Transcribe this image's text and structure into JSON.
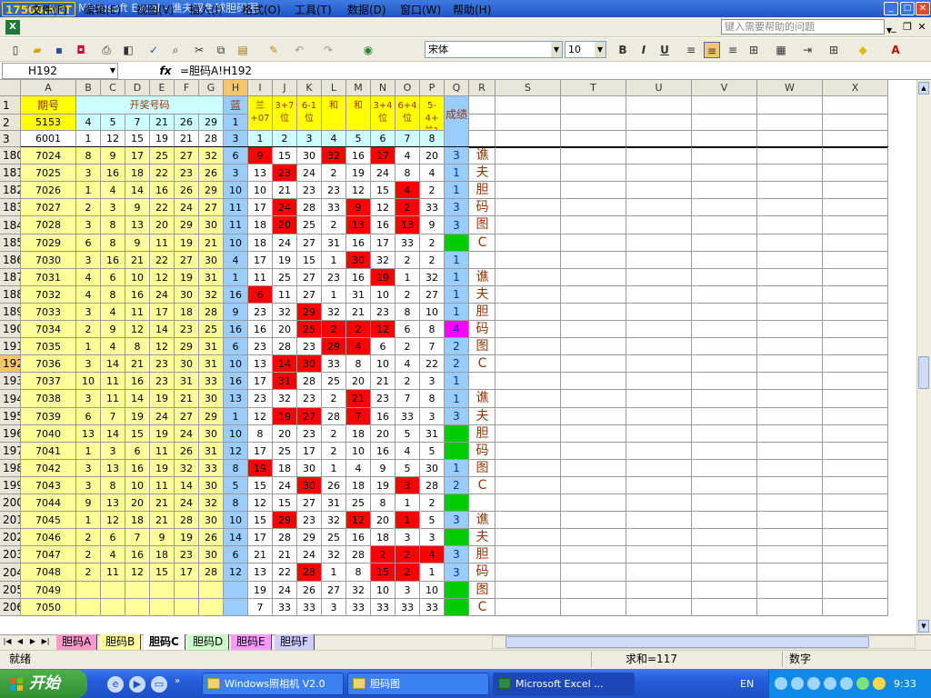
{
  "window": {
    "logo": "17500.NET",
    "title": "Microsoft Excel - 谯夫双色球胆码图"
  },
  "menu": [
    "文件(F)",
    "编辑(E)",
    "视图(V)",
    "插入(I)",
    "格式(O)",
    "工具(T)",
    "数据(D)",
    "窗口(W)",
    "帮助(H)"
  ],
  "help_placeholder": "键入需要帮助的问题",
  "font_name": "宋体",
  "font_size": "10",
  "name_box": "H192",
  "formula": "=胆码A!H192",
  "columns": [
    "A",
    "B",
    "C",
    "D",
    "E",
    "F",
    "G",
    "H",
    "I",
    "J",
    "K",
    "L",
    "M",
    "N",
    "O",
    "P",
    "Q",
    "R",
    "S",
    "T",
    "U",
    "V",
    "W",
    "X"
  ],
  "header": {
    "qihao": "期号",
    "kaijiang": "开奖号码",
    "lan": "蓝",
    "chengji": "成绩",
    "row2": [
      "5153",
      "4",
      "5",
      "7",
      "21",
      "26",
      "29",
      "1"
    ],
    "row3": [
      "6001",
      "1",
      "12",
      "15",
      "19",
      "21",
      "28",
      "3",
      "1",
      "2",
      "3",
      "4",
      "5",
      "6",
      "7",
      "8"
    ],
    "formulas": [
      "兰\n+07",
      "3+7\n位",
      "6-1\n位",
      "和",
      "和",
      "3+4\n位",
      "6+4\n位",
      "5-\n4+\n兰1"
    ]
  },
  "rows": [
    {
      "r": "180",
      "p": "7024",
      "b": [
        "8",
        "9",
        "17",
        "25",
        "27",
        "32"
      ],
      "blue": "6",
      "f": [
        "9",
        "15",
        "30",
        "32",
        "16",
        "17",
        "4",
        "20"
      ],
      "red": [
        0,
        3,
        5
      ],
      "q": "3"
    },
    {
      "r": "181",
      "p": "7025",
      "b": [
        "3",
        "16",
        "18",
        "22",
        "23",
        "26"
      ],
      "blue": "3",
      "f": [
        "13",
        "23",
        "24",
        "2",
        "19",
        "24",
        "8",
        "4"
      ],
      "red": [
        1
      ],
      "q": "1"
    },
    {
      "r": "182",
      "p": "7026",
      "b": [
        "1",
        "4",
        "14",
        "16",
        "26",
        "29"
      ],
      "blue": "10",
      "f": [
        "10",
        "21",
        "23",
        "23",
        "12",
        "15",
        "4",
        "2"
      ],
      "red": [
        6
      ],
      "q": "1"
    },
    {
      "r": "183",
      "p": "7027",
      "b": [
        "2",
        "3",
        "9",
        "22",
        "24",
        "27"
      ],
      "blue": "11",
      "f": [
        "17",
        "24",
        "28",
        "33",
        "9",
        "12",
        "2",
        "33"
      ],
      "red": [
        1,
        4,
        6
      ],
      "q": "3"
    },
    {
      "r": "184",
      "p": "7028",
      "b": [
        "3",
        "8",
        "13",
        "20",
        "29",
        "30"
      ],
      "blue": "11",
      "f": [
        "18",
        "20",
        "25",
        "2",
        "13",
        "16",
        "13",
        "9"
      ],
      "red": [
        1,
        4,
        6
      ],
      "q": "3"
    },
    {
      "r": "185",
      "p": "7029",
      "b": [
        "6",
        "8",
        "9",
        "11",
        "19",
        "21"
      ],
      "blue": "10",
      "f": [
        "18",
        "24",
        "27",
        "31",
        "16",
        "17",
        "33",
        "2"
      ],
      "red": [],
      "q": "",
      "green": true
    },
    {
      "r": "186",
      "p": "7030",
      "b": [
        "3",
        "16",
        "21",
        "22",
        "27",
        "30"
      ],
      "blue": "4",
      "f": [
        "17",
        "19",
        "15",
        "1",
        "30",
        "32",
        "2",
        "2"
      ],
      "red": [
        4
      ],
      "q": "1"
    },
    {
      "r": "187",
      "p": "7031",
      "b": [
        "4",
        "6",
        "10",
        "12",
        "19",
        "31"
      ],
      "blue": "1",
      "f": [
        "11",
        "25",
        "27",
        "23",
        "16",
        "19",
        "1",
        "32"
      ],
      "red": [
        5
      ],
      "q": "1"
    },
    {
      "r": "188",
      "p": "7032",
      "b": [
        "4",
        "8",
        "16",
        "24",
        "30",
        "32"
      ],
      "blue": "16",
      "f": [
        "6",
        "11",
        "27",
        "1",
        "31",
        "10",
        "2",
        "27"
      ],
      "red": [
        0
      ],
      "q": "1"
    },
    {
      "r": "189",
      "p": "7033",
      "b": [
        "3",
        "4",
        "11",
        "17",
        "18",
        "28"
      ],
      "blue": "9",
      "f": [
        "23",
        "32",
        "29",
        "32",
        "21",
        "23",
        "8",
        "10"
      ],
      "red": [
        2
      ],
      "q": "1"
    },
    {
      "r": "190",
      "p": "7034",
      "b": [
        "2",
        "9",
        "12",
        "14",
        "23",
        "25"
      ],
      "blue": "16",
      "f": [
        "16",
        "20",
        "25",
        "2",
        "2",
        "12",
        "6",
        "8"
      ],
      "red": [
        2,
        3,
        4,
        5
      ],
      "q": "4",
      "magenta": true
    },
    {
      "r": "191",
      "p": "7035",
      "b": [
        "1",
        "4",
        "8",
        "12",
        "29",
        "31"
      ],
      "blue": "6",
      "f": [
        "23",
        "28",
        "23",
        "29",
        "4",
        "6",
        "2",
        "7"
      ],
      "red": [
        3,
        4
      ],
      "q": "2"
    },
    {
      "r": "192",
      "p": "7036",
      "b": [
        "3",
        "14",
        "21",
        "23",
        "30",
        "31"
      ],
      "blue": "10",
      "f": [
        "13",
        "14",
        "30",
        "33",
        "8",
        "10",
        "4",
        "22"
      ],
      "red": [
        1,
        2
      ],
      "q": "2"
    },
    {
      "r": "193",
      "p": "7037",
      "b": [
        "10",
        "11",
        "16",
        "23",
        "31",
        "33"
      ],
      "blue": "16",
      "f": [
        "17",
        "31",
        "28",
        "25",
        "20",
        "21",
        "2",
        "3"
      ],
      "red": [
        1
      ],
      "q": "1"
    },
    {
      "r": "194",
      "p": "7038",
      "b": [
        "3",
        "11",
        "14",
        "19",
        "21",
        "30"
      ],
      "blue": "13",
      "f": [
        "23",
        "32",
        "23",
        "2",
        "21",
        "23",
        "7",
        "8"
      ],
      "red": [
        4
      ],
      "q": "1"
    },
    {
      "r": "195",
      "p": "7039",
      "b": [
        "6",
        "7",
        "19",
        "24",
        "27",
        "29"
      ],
      "blue": "1",
      "f": [
        "12",
        "19",
        "27",
        "28",
        "7",
        "16",
        "33",
        "3"
      ],
      "red": [
        1,
        2,
        4
      ],
      "q": "3"
    },
    {
      "r": "196",
      "p": "7040",
      "b": [
        "13",
        "14",
        "15",
        "19",
        "24",
        "30"
      ],
      "blue": "10",
      "f": [
        "8",
        "20",
        "23",
        "2",
        "18",
        "20",
        "5",
        "31"
      ],
      "red": [],
      "q": "",
      "green": true
    },
    {
      "r": "197",
      "p": "7041",
      "b": [
        "1",
        "3",
        "6",
        "11",
        "26",
        "31"
      ],
      "blue": "12",
      "f": [
        "17",
        "25",
        "17",
        "2",
        "10",
        "16",
        "4",
        "5"
      ],
      "red": [],
      "q": "",
      "green": true
    },
    {
      "r": "198",
      "p": "7042",
      "b": [
        "3",
        "13",
        "16",
        "19",
        "32",
        "33"
      ],
      "blue": "8",
      "f": [
        "19",
        "18",
        "30",
        "1",
        "4",
        "9",
        "5",
        "30"
      ],
      "red": [
        0
      ],
      "q": "1"
    },
    {
      "r": "199",
      "p": "7043",
      "b": [
        "3",
        "8",
        "10",
        "11",
        "14",
        "30"
      ],
      "blue": "5",
      "f": [
        "15",
        "24",
        "30",
        "26",
        "18",
        "19",
        "3",
        "28"
      ],
      "red": [
        2,
        6
      ],
      "q": "2"
    },
    {
      "r": "200",
      "p": "7044",
      "b": [
        "9",
        "13",
        "20",
        "21",
        "24",
        "32"
      ],
      "blue": "8",
      "f": [
        "12",
        "15",
        "27",
        "31",
        "25",
        "8",
        "1",
        "2"
      ],
      "red": [],
      "q": "",
      "green": true
    },
    {
      "r": "201",
      "p": "7045",
      "b": [
        "1",
        "12",
        "18",
        "21",
        "28",
        "30"
      ],
      "blue": "10",
      "f": [
        "15",
        "29",
        "23",
        "32",
        "12",
        "20",
        "1",
        "5"
      ],
      "red": [
        1,
        4,
        6
      ],
      "q": "3"
    },
    {
      "r": "202",
      "p": "7046",
      "b": [
        "2",
        "6",
        "7",
        "9",
        "19",
        "26"
      ],
      "blue": "14",
      "f": [
        "17",
        "28",
        "29",
        "25",
        "16",
        "18",
        "3",
        "3"
      ],
      "red": [],
      "q": "",
      "green": true
    },
    {
      "r": "203",
      "p": "7047",
      "b": [
        "2",
        "4",
        "16",
        "18",
        "23",
        "30"
      ],
      "blue": "6",
      "f": [
        "21",
        "21",
        "24",
        "32",
        "28",
        "2",
        "2",
        "4"
      ],
      "red": [
        5,
        6,
        7
      ],
      "q": "3"
    },
    {
      "r": "204",
      "p": "7048",
      "b": [
        "2",
        "11",
        "12",
        "15",
        "17",
        "28"
      ],
      "blue": "12",
      "f": [
        "13",
        "22",
        "28",
        "1",
        "8",
        "15",
        "2",
        "1"
      ],
      "red": [
        2,
        5,
        6
      ],
      "q": "3"
    },
    {
      "r": "205",
      "p": "7049",
      "b": [
        "",
        "",
        "",
        "",
        "",
        ""
      ],
      "blue": "",
      "f": [
        "19",
        "24",
        "26",
        "27",
        "32",
        "10",
        "3",
        "10"
      ],
      "red": [],
      "q": "",
      "green": true
    },
    {
      "r": "206",
      "p": "7050",
      "b": [
        "",
        "",
        "",
        "",
        "",
        ""
      ],
      "blue": "",
      "f": [
        "7",
        "33",
        "33",
        "3",
        "33",
        "33",
        "33",
        "33"
      ],
      "red": [],
      "q": "",
      "green": true
    }
  ],
  "r_column": [
    {
      "row": 0,
      "t": "谯"
    },
    {
      "row": 1,
      "t": "夫"
    },
    {
      "row": 2,
      "t": "胆"
    },
    {
      "row": 3,
      "t": "码"
    },
    {
      "row": 4,
      "t": "图"
    },
    {
      "row": 5,
      "t": "C"
    },
    {
      "row": 7,
      "t": "谯"
    },
    {
      "row": 8,
      "t": "夫"
    },
    {
      "row": 9,
      "t": "胆"
    },
    {
      "row": 10,
      "t": "码"
    },
    {
      "row": 11,
      "t": "图"
    },
    {
      "row": 12,
      "t": "C"
    },
    {
      "row": 14,
      "t": "谯"
    },
    {
      "row": 15,
      "t": "夫"
    },
    {
      "row": 16,
      "t": "胆"
    },
    {
      "row": 17,
      "t": "码"
    },
    {
      "row": 18,
      "t": "图"
    },
    {
      "row": 19,
      "t": "C"
    },
    {
      "row": 21,
      "t": "谯"
    },
    {
      "row": 22,
      "t": "夫"
    },
    {
      "row": 23,
      "t": "胆"
    },
    {
      "row": 24,
      "t": "码"
    },
    {
      "row": 25,
      "t": "图"
    },
    {
      "row": 26,
      "t": "C"
    }
  ],
  "sheets": [
    "胆码A",
    "胆码B",
    "胆码C",
    "胆码D",
    "胆码E",
    "胆码F"
  ],
  "active_sheet": 2,
  "status": {
    "ready": "就绪",
    "sum": "求和=117",
    "mode": "数字"
  },
  "taskbar": {
    "start": "开始",
    "tasks": [
      "Windows照相机 V2.0",
      "胆码图",
      "Microsoft Excel ..."
    ],
    "lang": "EN",
    "clock": "9:33"
  },
  "colors": {
    "yellow": "#ffff00",
    "lightyellow": "#ffff99",
    "blue": "#99ccff",
    "cyan": "#ccffff",
    "red": "#ff0000",
    "green": "#00cc00",
    "magenta": "#ff00ff",
    "darkred": "#993300"
  }
}
